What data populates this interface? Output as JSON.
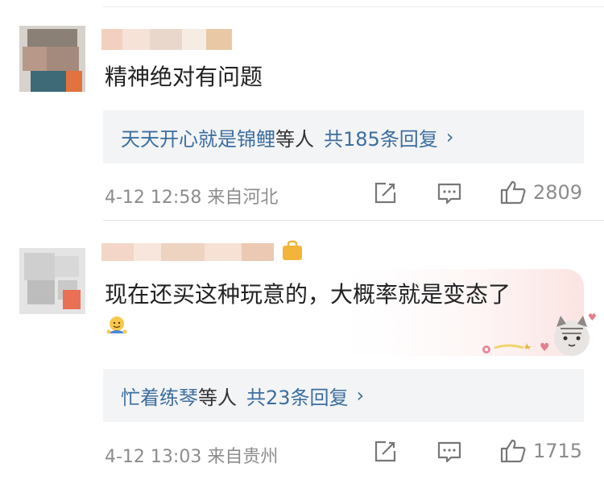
{
  "comments": [
    {
      "text": "精神绝对有问题",
      "reply_box": {
        "user_link": "天天开心就是锦鲤",
        "suffix": "等人",
        "count_link": "共185条回复",
        "chevron": "›"
      },
      "meta": "4-12 12:58 来自河北",
      "likes": "2809",
      "icons": [
        "share-icon",
        "comment-icon",
        "like-icon"
      ]
    },
    {
      "text": "现在还买这种玩意的，大概率就是变态了",
      "emoji": "emoji-face-icon",
      "reply_box": {
        "user_link": "忙着练琴",
        "suffix": "等人",
        "count_link": "共23条回复",
        "chevron": "›"
      },
      "meta": "4-12 13:03 来自贵州",
      "likes": "1715",
      "icons": [
        "share-icon",
        "comment-icon",
        "like-icon"
      ],
      "badge_icon": "member-badge-icon",
      "decor_icon": "cat-sticker-icon"
    }
  ],
  "colors": {
    "link": "#3c6e9f",
    "meta": "#8c8c8c",
    "reply_bg": "#f3f4f6",
    "text": "#222222"
  }
}
